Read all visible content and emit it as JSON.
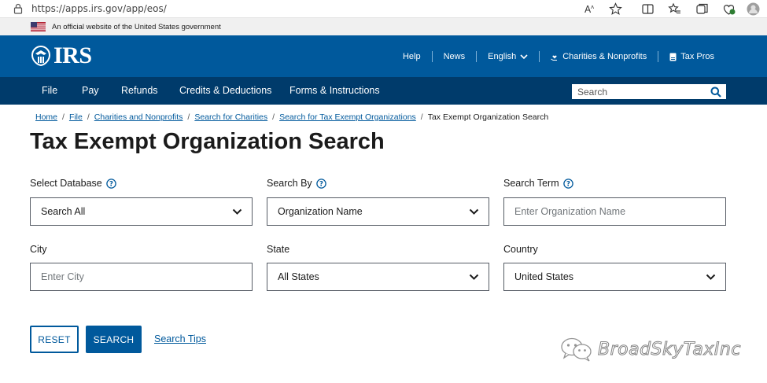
{
  "browser": {
    "url": "https://apps.irs.gov/app/eos/"
  },
  "gov_banner": {
    "text": "An official website of the United States government"
  },
  "header": {
    "logo_text": "IRS",
    "utility_nav": [
      {
        "label": "Help"
      },
      {
        "label": "News"
      },
      {
        "label": "English"
      },
      {
        "label": "Charities & Nonprofits"
      },
      {
        "label": "Tax Pros"
      }
    ]
  },
  "main_nav": {
    "items": [
      "File",
      "Pay",
      "Refunds",
      "Credits & Deductions",
      "Forms & Instructions"
    ],
    "search_placeholder": "Search"
  },
  "breadcrumb": {
    "links": [
      "Home",
      "File",
      "Charities and Nonprofits",
      "Search for Charities",
      "Search for Tax Exempt Organizations"
    ],
    "current": "Tax Exempt Organization Search"
  },
  "page": {
    "title": "Tax Exempt Organization Search"
  },
  "form": {
    "database": {
      "label": "Select Database",
      "value": "Search All"
    },
    "search_by": {
      "label": "Search By",
      "value": "Organization Name"
    },
    "search_term": {
      "label": "Search Term",
      "placeholder": "Enter Organization Name"
    },
    "city": {
      "label": "City",
      "placeholder": "Enter City"
    },
    "state": {
      "label": "State",
      "value": "All States"
    },
    "country": {
      "label": "Country",
      "value": "United States"
    }
  },
  "actions": {
    "reset": "RESET",
    "search": "SEARCH",
    "tips": "Search Tips"
  },
  "watermark": {
    "text": "BroadSkyTaxInc"
  },
  "colors": {
    "header_blue": "#00599c",
    "nav_dark_blue": "#003b6b",
    "link_blue": "#00599c"
  }
}
